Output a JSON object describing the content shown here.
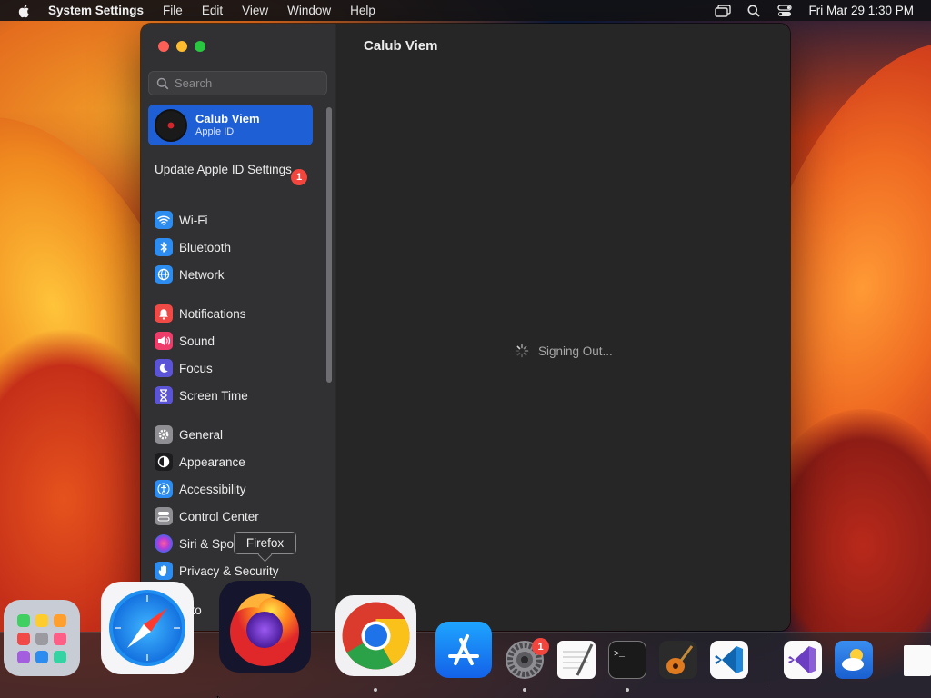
{
  "menubar": {
    "app_name": "System Settings",
    "menus": [
      "File",
      "Edit",
      "View",
      "Window",
      "Help"
    ],
    "clock": "Fri Mar 29  1:30 PM"
  },
  "window": {
    "title": "Calub Viem",
    "search": {
      "placeholder": "Search",
      "value": ""
    },
    "apple_id": {
      "name": "Calub Viem",
      "subtitle": "Apple ID"
    },
    "update": {
      "label": "Update Apple ID Settings",
      "badge": "1"
    },
    "sidebar": [
      {
        "label": "Wi-Fi",
        "icon": "wifi-icon",
        "color": "#2d8cf0"
      },
      {
        "label": "Bluetooth",
        "icon": "bluetooth-icon",
        "color": "#2d8cf0"
      },
      {
        "label": "Network",
        "icon": "globe-icon",
        "color": "#2d8cf0"
      },
      {
        "label": "Notifications",
        "icon": "bell-icon",
        "color": "#ef4a45"
      },
      {
        "label": "Sound",
        "icon": "speaker-icon",
        "color": "#ee3d6b"
      },
      {
        "label": "Focus",
        "icon": "moon-icon",
        "color": "#5b54d6"
      },
      {
        "label": "Screen Time",
        "icon": "hourglass-icon",
        "color": "#5b54d6"
      },
      {
        "label": "General",
        "icon": "gear-icon",
        "color": "#8e8e93"
      },
      {
        "label": "Appearance",
        "icon": "appearance-icon",
        "color": "#1c1c1e"
      },
      {
        "label": "Accessibility",
        "icon": "accessibility-icon",
        "color": "#2d8cf0"
      },
      {
        "label": "Control Center",
        "icon": "control-center-icon",
        "color": "#8e8e93"
      },
      {
        "label": "Siri & Spo",
        "icon": "siri-icon",
        "color": "#b73cd6"
      },
      {
        "label": "Privacy & Security",
        "icon": "hand-icon",
        "color": "#2d8cf0"
      },
      {
        "label": "skto",
        "icon": "desktop-icon",
        "color": "#2d8cf0"
      }
    ],
    "status": "Signing Out..."
  },
  "tooltip": {
    "label": "Firefox"
  },
  "dock": {
    "apps": [
      "Launchpad",
      "Safari",
      "Firefox",
      "Chrome",
      "App Store",
      "System Settings",
      "TextEdit",
      "Terminal",
      "GarageBand",
      "Visual Studio Code",
      "Visual Studio",
      "Weather",
      "Document"
    ],
    "settings_badge": "1"
  }
}
